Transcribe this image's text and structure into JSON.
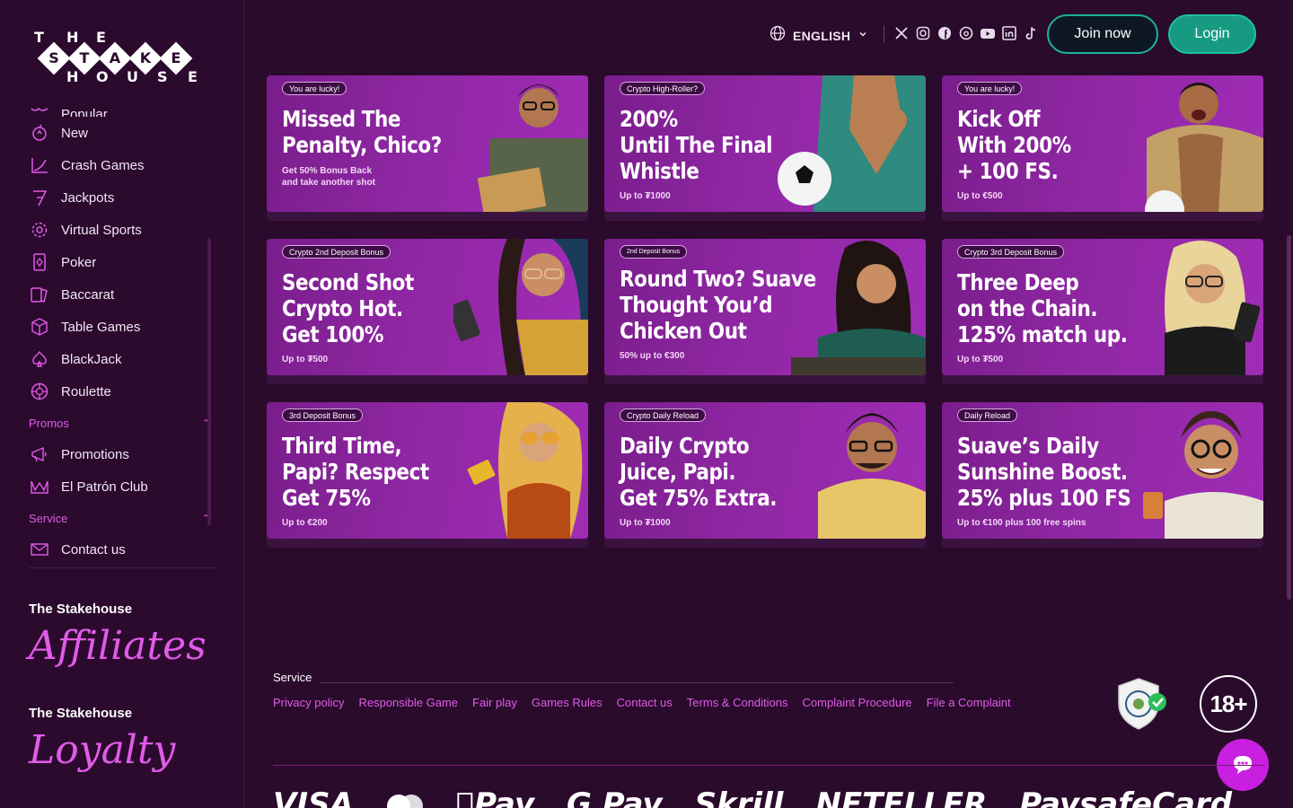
{
  "logo": {
    "top_letters": [
      "T",
      "H",
      "E"
    ],
    "diamond_letters": [
      "S",
      "T",
      "A",
      "K",
      "E"
    ],
    "bottom_letters": [
      "H",
      "O",
      "U",
      "S",
      "E"
    ]
  },
  "sidebar": {
    "items_top": [
      {
        "label": "Popular",
        "icon": "popular-icon"
      },
      {
        "label": "New",
        "icon": "new-icon"
      },
      {
        "label": "Crash Games",
        "icon": "crash-games-icon"
      },
      {
        "label": "Jackpots",
        "icon": "jackpot-seven-icon"
      },
      {
        "label": "Virtual Sports",
        "icon": "gear-icon"
      },
      {
        "label": "Poker",
        "icon": "card-icon"
      },
      {
        "label": "Baccarat",
        "icon": "cards-icon"
      },
      {
        "label": "Table Games",
        "icon": "cube-icon"
      },
      {
        "label": "BlackJack",
        "icon": "spade-icon"
      },
      {
        "label": "Roulette",
        "icon": "roulette-icon"
      }
    ],
    "promos_section": "Promos",
    "promos_items": [
      {
        "label": "Promotions",
        "icon": "megaphone-icon"
      },
      {
        "label": "El Patrón Club",
        "icon": "crown-icon"
      }
    ],
    "service_section": "Service",
    "service_items": [
      {
        "label": "Contact us",
        "icon": "mail-icon"
      }
    ],
    "affiliates_title": "The Stakehouse",
    "affiliates_script": "Affiliates",
    "loyalty_title": "The Stakehouse",
    "loyalty_script": "Loyalty"
  },
  "header": {
    "language": "ENGLISH",
    "socials": [
      "x-icon",
      "instagram-icon",
      "facebook-icon",
      "threads-icon",
      "youtube-icon",
      "linkedin-icon",
      "tiktok-icon"
    ],
    "join_label": "Join now",
    "login_label": "Login"
  },
  "promos": [
    {
      "badge": "You are lucky!",
      "title": "Missed The\nPenalty, Chico?",
      "sub": "Get 50% Bonus Back\nand take another shot"
    },
    {
      "badge": "Crypto High-Roller?",
      "title": "200%\nUntil The Final\nWhistle",
      "sub": "Up to ₮1000"
    },
    {
      "badge": "You are lucky!",
      "title": "Kick Off\nWith 200%\n+ 100 FS.",
      "sub": "Up to €500"
    },
    {
      "badge": "Crypto 2nd Deposit Bonus",
      "title": "Second Shot\nCrypto Hot.\nGet 100%",
      "sub": "Up to ₮500"
    },
    {
      "badge": "2nd Deposit Bonus",
      "title": "Round Two? Suave\nThought You’d\nChicken Out",
      "sub": "50% up to €300"
    },
    {
      "badge": "Crypto 3rd Deposit Bonus",
      "title": "Three Deep\non the Chain.\n125% match up.",
      "sub": "Up to ₮500"
    },
    {
      "badge": "3rd Deposit Bonus",
      "title": "Third Time,\nPapi? Respect\nGet 75%",
      "sub": "Up to €200"
    },
    {
      "badge": "Crypto Daily Reload",
      "title": "Daily Crypto\nJuice, Papi.\nGet 75% Extra.",
      "sub": "Up to ₮1000"
    },
    {
      "badge": "Daily Reload",
      "title": "Suave’s Daily\nSunshine Boost.\n25% plus 100 FS",
      "sub": "Up to €100 plus 100 free spins"
    }
  ],
  "footer": {
    "service_label": "Service",
    "links": [
      "Privacy policy",
      "Responsible Game",
      "Fair play",
      "Games Rules",
      "Contact us",
      "Terms & Conditions",
      "Complaint Procedure",
      "File a Complaint"
    ],
    "age_badge": "18+",
    "payments": [
      "VISA",
      "",
      "Pay",
      "G Pay",
      "Skrill",
      "NETELLER",
      "PaysafeCard"
    ]
  },
  "colors": {
    "accent": "#e05be8",
    "background": "#2a0b2c",
    "join_border": "#1bb39a",
    "login_bg": "#179a82",
    "card_purple": "#8f27a3"
  }
}
